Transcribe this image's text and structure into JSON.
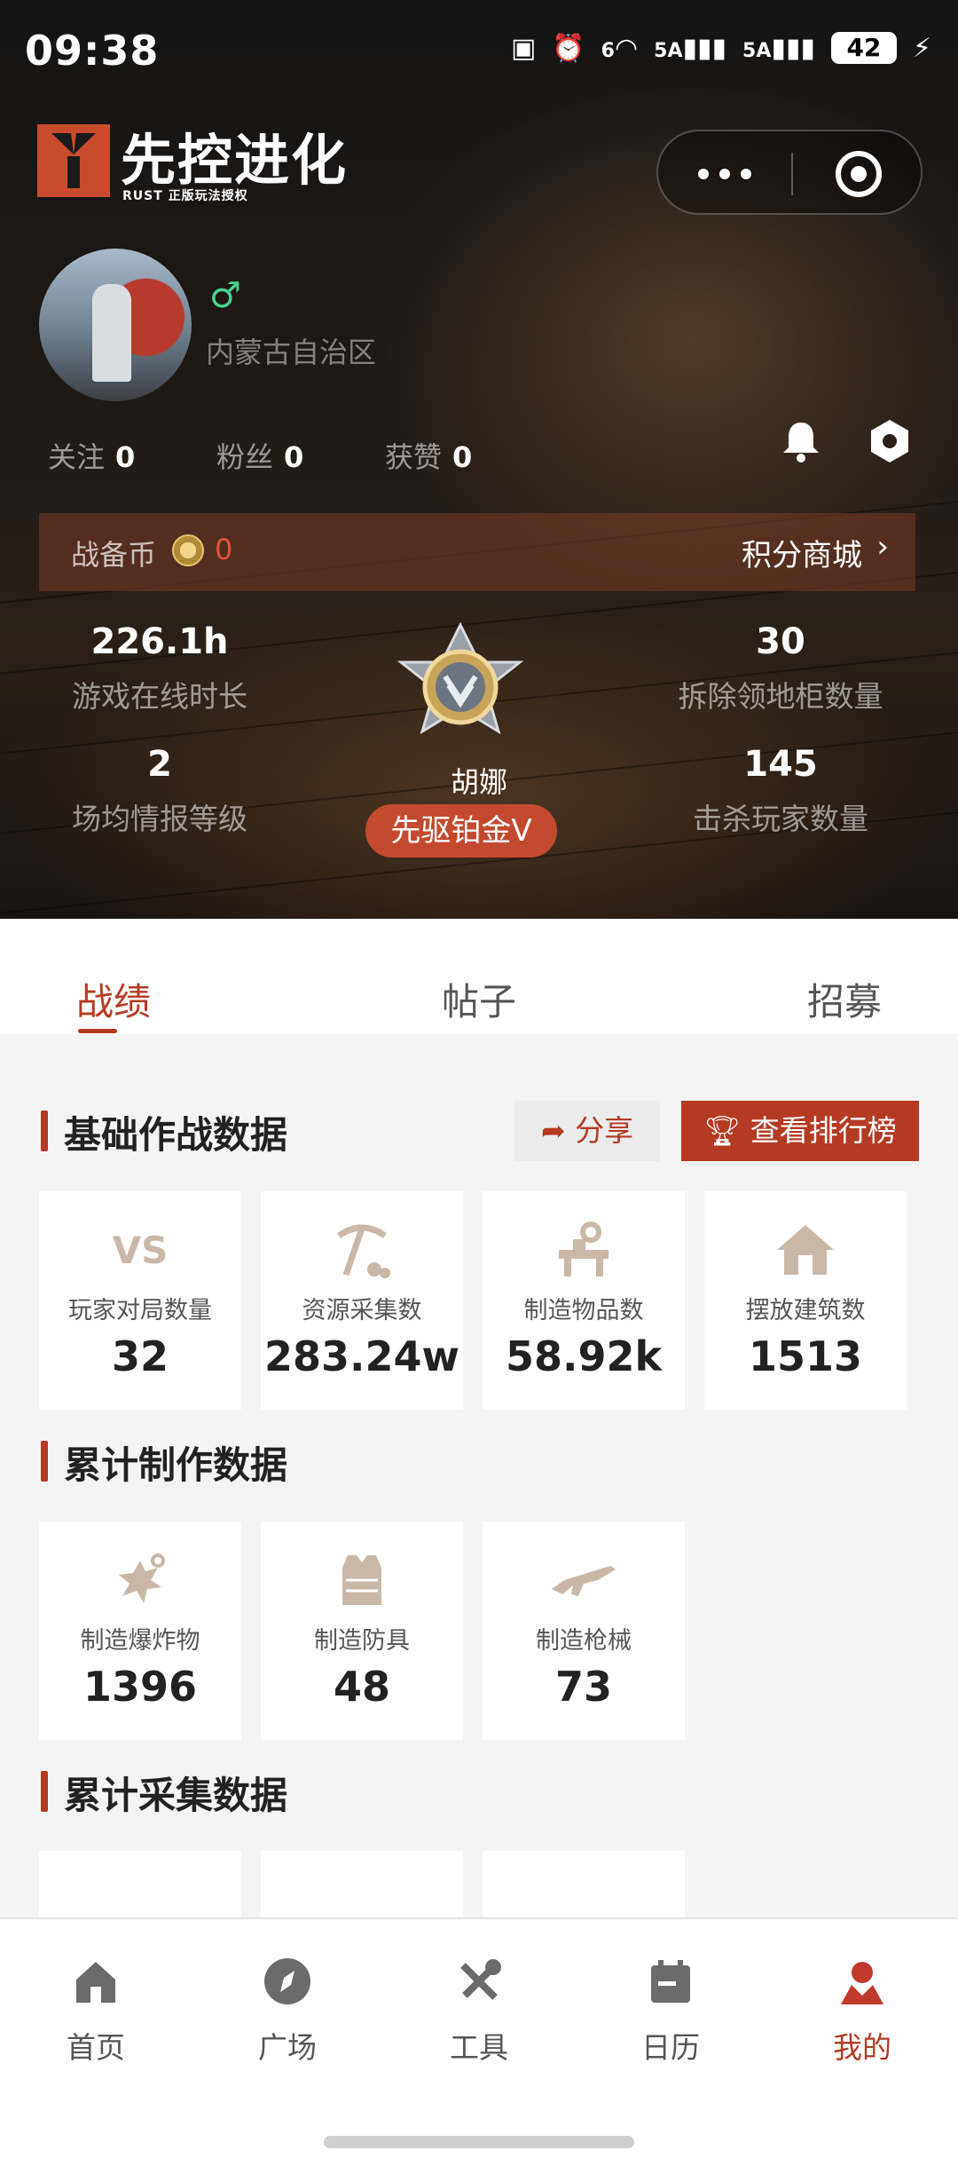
{
  "status_bar": {
    "time": "09:38",
    "battery": "42",
    "signal_1": "5A",
    "signal_2": "5A",
    "wifi": "6"
  },
  "app": {
    "title": "先控进化",
    "subtitle": "RUST 正版玩法授权"
  },
  "profile": {
    "region": "内蒙古自治区",
    "gender_icon": "male-icon",
    "gender_color": "#4bd18f"
  },
  "follow_stats": [
    {
      "label": "关注",
      "value": "0"
    },
    {
      "label": "粉丝",
      "value": "0"
    },
    {
      "label": "获赞",
      "value": "0"
    }
  ],
  "coin_bar": {
    "label": "战备币",
    "count": "0",
    "mall_label": "积分商城"
  },
  "stats": {
    "online_hours": {
      "value": "226.1h",
      "label": "游戏在线时长"
    },
    "cabinets": {
      "value": "30",
      "label": "拆除领地柜数量"
    },
    "intel": {
      "value": "2",
      "label": "场均情报等级"
    },
    "kills": {
      "value": "145",
      "label": "击杀玩家数量"
    }
  },
  "rank": {
    "name": "胡娜",
    "tier": "先驱铂金V"
  },
  "tabs": [
    {
      "label": "战绩",
      "active": true
    },
    {
      "label": "帖子",
      "active": false
    },
    {
      "label": "招募",
      "active": false
    }
  ],
  "section_combat": {
    "title": "基础作战数据",
    "share_label": "分享",
    "ranking_label": "查看排行榜",
    "cards": [
      {
        "icon": "vs-icon",
        "label": "玩家对局数量",
        "value": "32"
      },
      {
        "icon": "pickaxe-icon",
        "label": "资源采集数",
        "value": "283.24w"
      },
      {
        "icon": "workbench-icon",
        "label": "制造物品数",
        "value": "58.92k"
      },
      {
        "icon": "house-icon",
        "label": "摆放建筑数",
        "value": "1513"
      }
    ]
  },
  "section_craft": {
    "title": "累计制作数据",
    "cards": [
      {
        "icon": "explosive-icon",
        "label": "制造爆炸物",
        "value": "1396"
      },
      {
        "icon": "armor-icon",
        "label": "制造防具",
        "value": "48"
      },
      {
        "icon": "rifle-icon",
        "label": "制造枪械",
        "value": "73"
      }
    ]
  },
  "section_gather": {
    "title": "累计采集数据"
  },
  "bottom_nav": [
    {
      "label": "首页",
      "icon": "home-icon",
      "active": false
    },
    {
      "label": "广场",
      "icon": "compass-icon",
      "active": false
    },
    {
      "label": "工具",
      "icon": "tools-icon",
      "active": false
    },
    {
      "label": "日历",
      "icon": "calendar-icon",
      "active": false
    },
    {
      "label": "我的",
      "icon": "user-icon",
      "active": true
    }
  ],
  "colors": {
    "accent": "#b43a22",
    "badge": "#c34a2f",
    "coin_count": "#e0533a"
  }
}
